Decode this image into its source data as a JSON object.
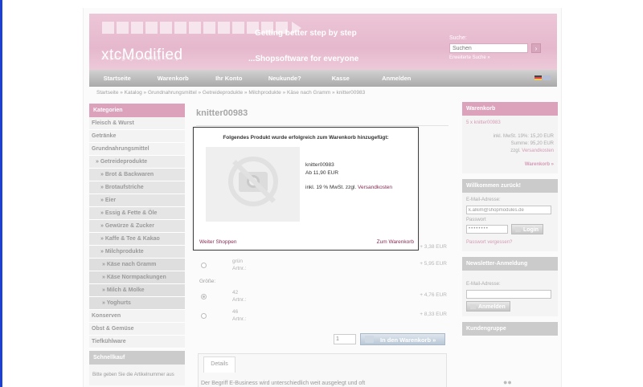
{
  "colors": {
    "brand_pink": "#e6b8cd",
    "link_purple": "#8a2a54",
    "nav_grey": "#a9a9a9",
    "screen_edge_blue": "#1c3fd6"
  },
  "header": {
    "logo": "xtcModified",
    "tagline_top": "Getting better step by step",
    "tagline_bottom": "...Shopsoftware for everyone",
    "search_label": "Suche:",
    "search_value": "Suchen",
    "search_icon": "chevron-right-icon",
    "advanced_search": "Erweiterte Suche »"
  },
  "nav": {
    "items": [
      "Startseite",
      "Warenkorb",
      "Ihr Konto",
      "Neukunde?",
      "Kasse",
      "Anmelden"
    ],
    "flags": [
      "german-flag-icon",
      "english-flag-icon"
    ]
  },
  "breadcrumb": "Startseite » Katalog » Grundnahrungsmittel » Getreideprodukte » Milchprodukte » Käse nach Gramm » knitter00983",
  "categories": {
    "header": "Kategorien",
    "items": [
      {
        "label": "Fleisch & Wurst",
        "level": 0
      },
      {
        "label": "Getränke",
        "level": 0
      },
      {
        "label": "Grundnahrungsmittel",
        "level": 0
      },
      {
        "label": "» Getreideprodukte",
        "level": 1
      },
      {
        "label": "» Brot & Backwaren",
        "level": 2
      },
      {
        "label": "» Brotaufstriche",
        "level": 2
      },
      {
        "label": "» Eier",
        "level": 2
      },
      {
        "label": "» Essig & Fette & Öle",
        "level": 2
      },
      {
        "label": "» Gewürze & Zucker",
        "level": 2
      },
      {
        "label": "» Kaffe & Tee & Kakao",
        "level": 2
      },
      {
        "label": "» Milchprodukte",
        "level": 2
      },
      {
        "label": "» Käse nach Gramm",
        "level": 3
      },
      {
        "label": "» Käse Normpackungen",
        "level": 3
      },
      {
        "label": "» Milch & Molke",
        "level": 3
      },
      {
        "label": "» Yoghurts",
        "level": 3
      },
      {
        "label": "Konserven",
        "level": 0
      },
      {
        "label": "Obst & Gemüse",
        "level": 0
      },
      {
        "label": "Tiefkühlware",
        "level": 0
      }
    ]
  },
  "schnellkauf": {
    "header": "Schnellkauf",
    "text": "Bitte geben Sie die Artikelnummer aus"
  },
  "product": {
    "title": "knitter00983",
    "options": [
      {
        "name": "grün",
        "sub": "Artnr.:",
        "price": "+ 5,95 EUR",
        "checked": false
      },
      {
        "name": "42",
        "sub": "Artnr.:",
        "price": "+ 4,76 EUR",
        "checked": true
      },
      {
        "name": "46",
        "sub": "Artnr.:",
        "price": "+ 8,33 EUR",
        "checked": false
      }
    ],
    "hidden_price": "+ 3,38 EUR",
    "size_label": "Größe:",
    "quantity": "1",
    "cart_button": "In den Warenkorb »",
    "details_tab": "Details",
    "details_text": "Der Begriff E-Business wird unterschiedlich weit ausgelegt und oft"
  },
  "modal": {
    "title": "Folgendes Produkt wurde erfolgreich zum Warenkorb hinzugefügt:",
    "product_name": "knitter00983",
    "price": "Ab 11,90 EUR",
    "tax_text": "inkl. 19 % MwSt. zzgl.",
    "shipping_link": "Versandkosten",
    "continue": "Weiter Shoppen",
    "to_cart": "Zum Warenkorb"
  },
  "right": {
    "cart": {
      "header": "Warenkorb",
      "item": "5 x knitter00983",
      "tax": "inkl. MwSt. 19%: 15,20 EUR",
      "sum": "Summe: 95,20 EUR",
      "shipping_prefix": "zzgl.",
      "shipping_link": "Versandkosten",
      "link": "Warenkorb »"
    },
    "login": {
      "header": "Willkommen zurück!",
      "email_label": "E-Mail-Adresse:",
      "email_value": "k.alkim@shopmodules.de",
      "password_label": "Passwort",
      "password_value": "••••••••",
      "login_button": "Login",
      "forgot": "Passwort vergessen?"
    },
    "newsletter": {
      "header": "Newsletter-Anmeldung",
      "email_label": "E-Mail-Adresse:",
      "email_value": "",
      "button": "Anmelden"
    },
    "customer_group": {
      "header": "Kundengruppe",
      "icon": "customer-group-icon"
    }
  }
}
